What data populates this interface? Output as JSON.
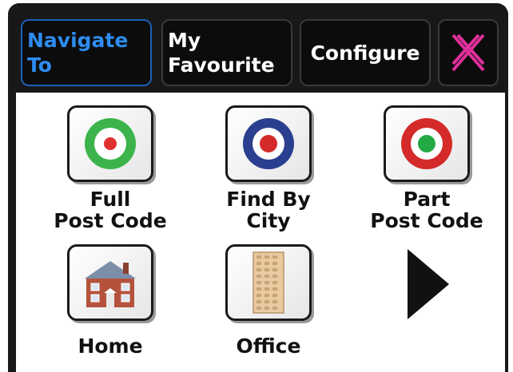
{
  "tabs": {
    "navigate_to": "Navigate\nTo",
    "my_favourite": "My\nFavourite",
    "configure": "Configure",
    "close_icon": "close-icon"
  },
  "items": [
    {
      "label": "Full\nPost Code",
      "icon": "green-target-icon",
      "ring_color": "#3cb44b",
      "dot_color": "#e03030"
    },
    {
      "label": "Find By\nCity",
      "icon": "blue-target-icon",
      "ring_color": "#2a3f8f",
      "dot_color": "#d42a2a"
    },
    {
      "label": "Part\nPost Code",
      "icon": "red-target-icon",
      "ring_color": "#d42a2a",
      "dot_color": "#22aa44"
    },
    {
      "label": "Home",
      "icon": "house-icon"
    },
    {
      "label": "Office",
      "icon": "office-building-icon"
    }
  ],
  "next_icon": "next-page-arrow-icon",
  "colors": {
    "frame": "#181818",
    "active_tab_text": "#2d8cf0",
    "close_x": "#e0309a"
  }
}
